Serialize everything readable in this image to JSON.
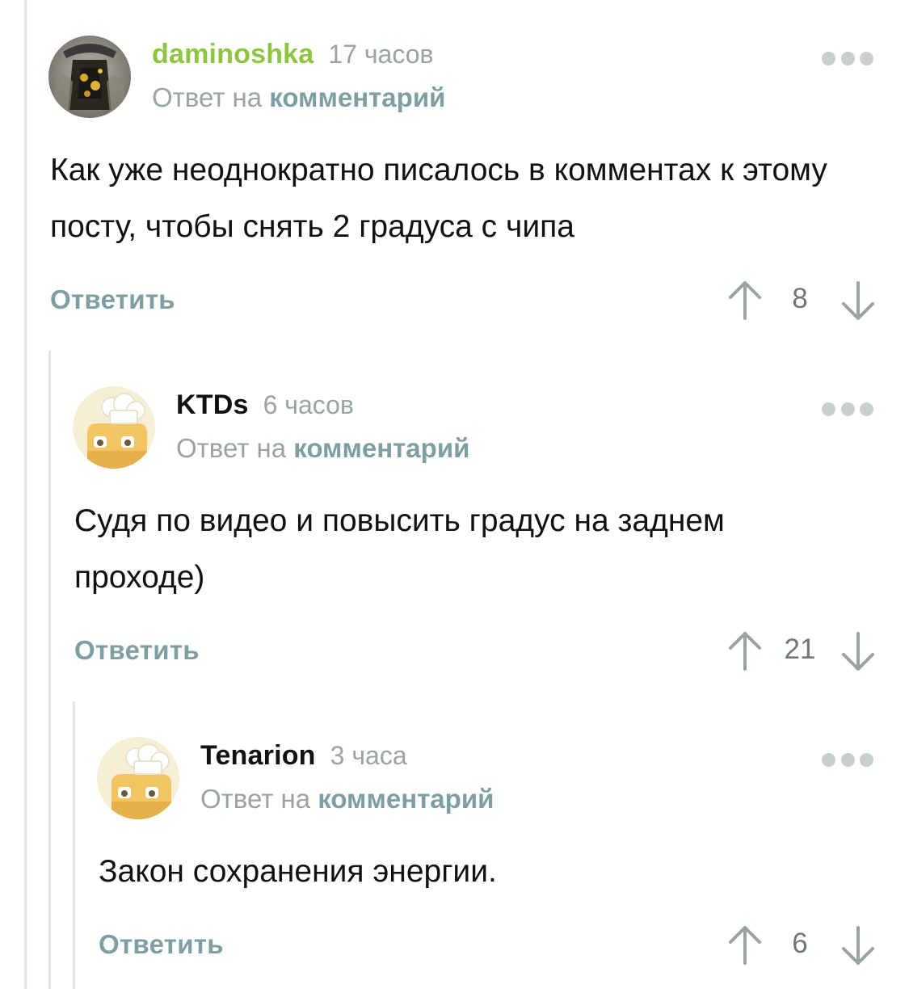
{
  "comments": [
    {
      "username": "daminoshka",
      "username_color": "#8cc63f",
      "time": "17 часов",
      "reply_prefix": "Ответ на",
      "reply_link": "комментарий",
      "text": "Как уже неоднократно писалось в комментах к этому посту, чтобы снять 2 градуса с чипа",
      "reply_label": "Ответить",
      "votes": "8",
      "avatar": "user-photo-avatar"
    },
    {
      "username": "KTDs",
      "username_color": "#111111",
      "time": "6 часов",
      "reply_prefix": "Ответ на",
      "reply_link": "комментарий",
      "text": "Судя по видео и повысить градус на заднем проходе)",
      "reply_label": "Ответить",
      "votes": "21",
      "avatar": "default-chef-avatar"
    },
    {
      "username": "Tenarion",
      "username_color": "#111111",
      "time": "3 часа",
      "reply_prefix": "Ответ на",
      "reply_link": "комментарий",
      "text": "Закон сохранения энергии.",
      "reply_label": "Ответить",
      "votes": "6",
      "avatar": "default-chef-avatar"
    }
  ],
  "icons": {
    "more": "more-dots-icon",
    "upvote": "arrow-up-icon",
    "downvote": "arrow-down-icon"
  },
  "colors": {
    "accent": "#7d9ea2",
    "muted": "#9aa3a3",
    "thread_line": "#e3e6e6",
    "dots": "#c8cfcf"
  }
}
